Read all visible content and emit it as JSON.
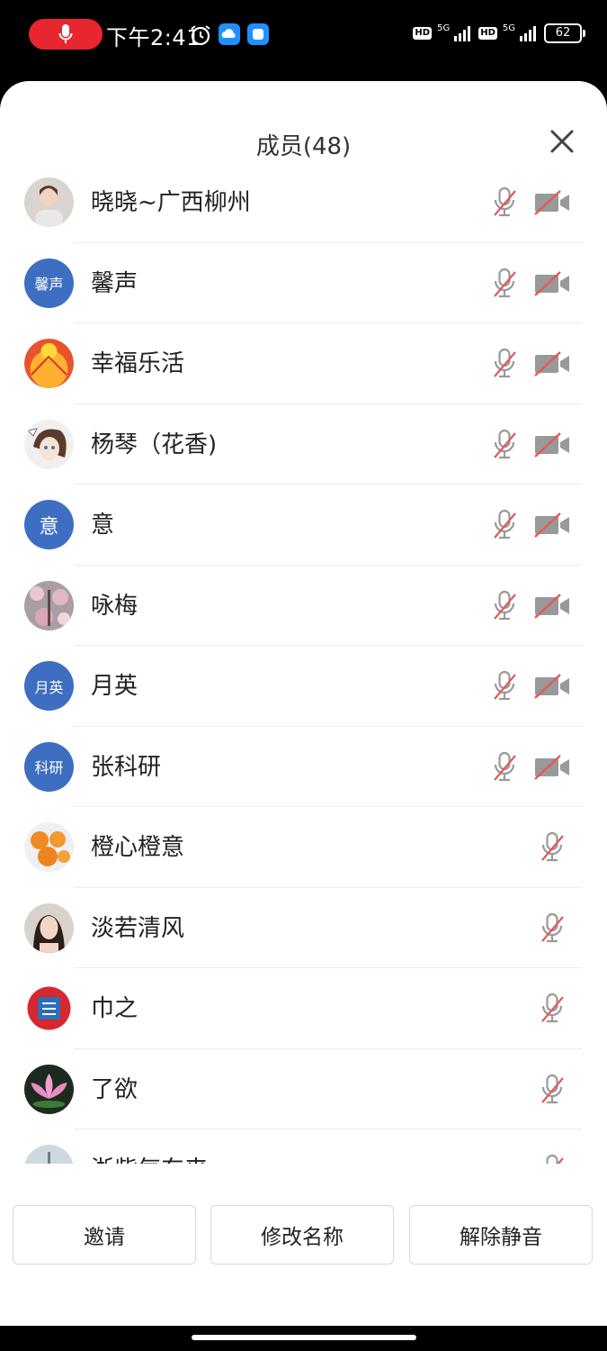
{
  "status_bar": {
    "time": "下午2:41",
    "network_1": "5G",
    "network_2": "5G",
    "hd_label": "HD",
    "battery": "62"
  },
  "sheet": {
    "title": "成员(48)"
  },
  "members": [
    {
      "name": "晓晓~广西柳州",
      "avatar_type": "photo",
      "avatar_text": "",
      "mic_muted": true,
      "cam_off": true
    },
    {
      "name": "馨声",
      "avatar_type": "text",
      "avatar_text": "馨声",
      "mic_muted": true,
      "cam_off": true
    },
    {
      "name": "幸福乐活",
      "avatar_type": "photo",
      "avatar_text": "",
      "mic_muted": true,
      "cam_off": true
    },
    {
      "name": "杨琴（花香)",
      "avatar_type": "photo",
      "avatar_text": "",
      "mic_muted": true,
      "cam_off": true
    },
    {
      "name": "意",
      "avatar_type": "text",
      "avatar_text": "意",
      "mic_muted": true,
      "cam_off": true
    },
    {
      "name": "咏梅",
      "avatar_type": "photo",
      "avatar_text": "",
      "mic_muted": true,
      "cam_off": true
    },
    {
      "name": "月英",
      "avatar_type": "text",
      "avatar_text": "月英",
      "mic_muted": true,
      "cam_off": true
    },
    {
      "name": "张科研",
      "avatar_type": "text",
      "avatar_text": "科研",
      "mic_muted": true,
      "cam_off": true
    },
    {
      "name": "橙心橙意",
      "avatar_type": "photo",
      "avatar_text": "",
      "mic_muted": true,
      "cam_off": false
    },
    {
      "name": "淡若清风",
      "avatar_type": "photo",
      "avatar_text": "",
      "mic_muted": true,
      "cam_off": false
    },
    {
      "name": "巾之",
      "avatar_type": "photo",
      "avatar_text": "",
      "mic_muted": true,
      "cam_off": false
    },
    {
      "name": "了欲",
      "avatar_type": "photo",
      "avatar_text": "",
      "mic_muted": true,
      "cam_off": false
    },
    {
      "name": "浙紫气东来",
      "avatar_type": "photo",
      "avatar_text": "",
      "mic_muted": true,
      "cam_off": false
    }
  ],
  "buttons": {
    "invite": "邀请",
    "rename": "修改名称",
    "unmute": "解除静音"
  },
  "colors": {
    "accent_blue": "#3d6ec1",
    "muted_red": "#e05a5a",
    "record_red": "#e8262f"
  }
}
